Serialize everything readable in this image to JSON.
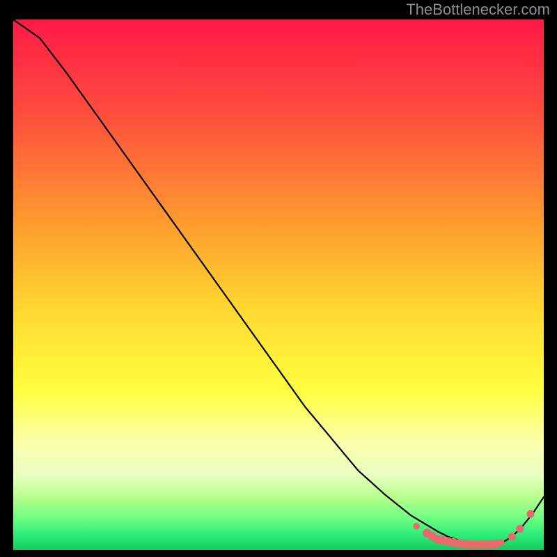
{
  "watermark": "TheBottlenecker.com",
  "chart_data": {
    "type": "line",
    "title": "",
    "xlabel": "",
    "ylabel": "",
    "xlim": [
      0,
      100
    ],
    "ylim": [
      0,
      100
    ],
    "gradient_colors_top_to_bottom": [
      "#ff1a46",
      "#ff5a3a",
      "#ffb12e",
      "#ffe733",
      "#f8ff7a",
      "#b7ff8c",
      "#2fef7a",
      "#13c95e"
    ],
    "curve": {
      "name": "bottleneck-curve",
      "x": [
        0,
        5,
        10,
        15,
        20,
        25,
        30,
        35,
        40,
        45,
        50,
        55,
        60,
        65,
        70,
        75,
        80,
        82,
        85,
        88,
        90,
        92,
        94,
        96,
        98,
        100
      ],
      "y": [
        100,
        96.5,
        90,
        83,
        76,
        69,
        62,
        55,
        48,
        41,
        34,
        27,
        21,
        15,
        10.5,
        6.5,
        3.5,
        2.5,
        1.5,
        1.0,
        1.0,
        1.3,
        2.5,
        4.5,
        7.0,
        10.0
      ]
    },
    "markers": {
      "name": "dot-cluster",
      "color": "#e86a6a",
      "points": [
        {
          "x": 76,
          "y": 4.5,
          "r": 3
        },
        {
          "x": 78,
          "y": 3.2,
          "r": 4
        },
        {
          "x": 79,
          "y": 2.6,
          "r": 4
        },
        {
          "x": 80,
          "y": 2.0,
          "r": 4
        },
        {
          "x": 81,
          "y": 1.8,
          "r": 4
        },
        {
          "x": 82,
          "y": 1.6,
          "r": 4
        },
        {
          "x": 83,
          "y": 1.4,
          "r": 4
        },
        {
          "x": 84,
          "y": 1.2,
          "r": 4
        },
        {
          "x": 85,
          "y": 1.1,
          "r": 4
        },
        {
          "x": 86,
          "y": 1.0,
          "r": 4
        },
        {
          "x": 87,
          "y": 1.0,
          "r": 4
        },
        {
          "x": 88,
          "y": 1.0,
          "r": 4
        },
        {
          "x": 89,
          "y": 1.0,
          "r": 4
        },
        {
          "x": 90,
          "y": 1.0,
          "r": 4
        },
        {
          "x": 91,
          "y": 1.1,
          "r": 4
        },
        {
          "x": 92,
          "y": 1.4,
          "r": 3
        },
        {
          "x": 94,
          "y": 2.5,
          "r": 3.5
        },
        {
          "x": 95.5,
          "y": 4.0,
          "r": 3.5
        },
        {
          "x": 97.5,
          "y": 6.8,
          "r": 3.5
        }
      ]
    }
  }
}
